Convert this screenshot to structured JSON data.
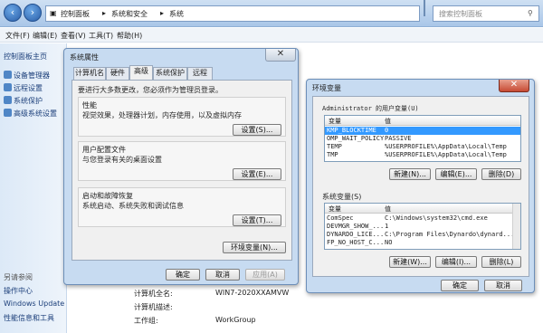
{
  "address": {
    "crumbs": [
      "控制面板",
      "系统和安全",
      "系统"
    ],
    "search_placeholder": "搜索控制面板"
  },
  "menu": [
    "文件(F)",
    "编辑(E)",
    "查看(V)",
    "工具(T)",
    "帮助(H)"
  ],
  "left_pane": {
    "home": "控制面板主页",
    "links": [
      "设备管理器",
      "远程设置",
      "系统保护",
      "高级系统设置"
    ],
    "see_also": "另请参阅",
    "see_also_links": [
      "操作中心",
      "Windows Update",
      "性能信息和工具"
    ]
  },
  "system_info": {
    "rows": [
      {
        "label": "计算机全名:",
        "value": "WIN7-2020XXAMVW"
      },
      {
        "label": "计算机描述:",
        "value": ""
      },
      {
        "label": "工作组:",
        "value": "WorkGroup"
      }
    ]
  },
  "sysprops": {
    "title": "系统属性",
    "tabs": [
      "计算机名",
      "硬件",
      "高级",
      "系统保护",
      "远程"
    ],
    "admin_note": "要进行大多数更改，您必须作为管理员登录。",
    "performance": {
      "title": "性能",
      "desc": "视觉效果，处理器计划，内存使用，以及虚拟内存",
      "button": "设置(S)..."
    },
    "profiles": {
      "title": "用户配置文件",
      "desc": "与您登录有关的桌面设置",
      "button": "设置(E)..."
    },
    "startup": {
      "title": "启动和故障恢复",
      "desc": "系统启动、系统失败和调试信息",
      "button": "设置(T)..."
    },
    "env_button": "环境变量(N)...",
    "ok": "确定",
    "cancel": "取消",
    "apply": "应用(A)"
  },
  "envvars": {
    "title": "环境变量",
    "user_label": "Administrator 的用户变量(U)",
    "columns": [
      "变量",
      "值"
    ],
    "user_rows": [
      {
        "name": "KMP_BLOCKTIME",
        "value": "0"
      },
      {
        "name": "OMP_WAIT_POLICY",
        "value": "PASSIVE"
      },
      {
        "name": "TEMP",
        "value": "%USERPROFILE%\\AppData\\Local\\Temp"
      },
      {
        "name": "TMP",
        "value": "%USERPROFILE%\\AppData\\Local\\Temp"
      }
    ],
    "system_label": "系统变量(S)",
    "system_rows": [
      {
        "name": "ComSpec",
        "value": "C:\\Windows\\system32\\cmd.exe"
      },
      {
        "name": "DEVMGR_SHOW_...",
        "value": "1"
      },
      {
        "name": "DYNARDO_LICE...",
        "value": "C:\\Program Files\\Dynardo\\dynard..."
      },
      {
        "name": "FP_NO_HOST_C...",
        "value": "NO"
      }
    ],
    "new_user": "新建(N)...",
    "edit_user": "编辑(E)...",
    "delete_user": "删除(D)",
    "new_sys": "新建(W)...",
    "edit_sys": "编辑(I)...",
    "delete_sys": "删除(L)",
    "ok": "确定",
    "cancel": "取消"
  },
  "colors": {
    "selection": "#3399ff",
    "dialog_frame": "#c7dbf1",
    "close_button": "#c74a33"
  }
}
